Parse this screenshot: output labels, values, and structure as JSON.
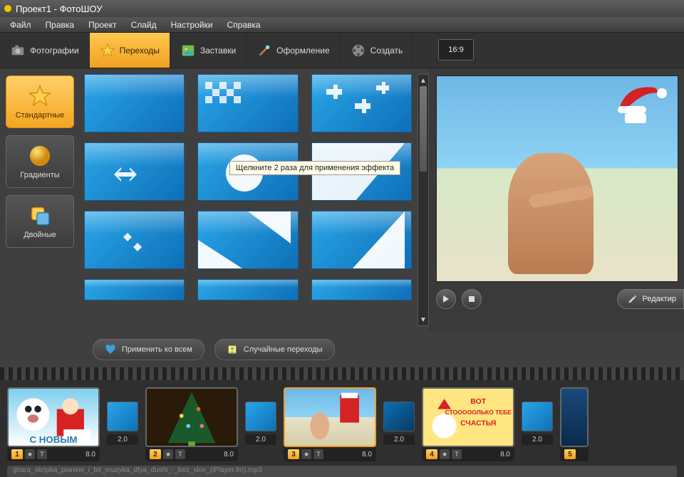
{
  "title": "Проект1 - ФотоШОУ",
  "menu": [
    "Файл",
    "Правка",
    "Проект",
    "Слайд",
    "Настройки",
    "Справка"
  ],
  "tabs": {
    "photos": "Фотографии",
    "transitions": "Переходы",
    "splash": "Заставки",
    "design": "Оформление",
    "create": "Создать"
  },
  "aspect": "16:9",
  "categories": {
    "standard": "Стандартные",
    "gradients": "Градиенты",
    "double": "Двойные"
  },
  "tooltip": "Щелкните 2 раза для применения эффекта",
  "buttons": {
    "apply_all": "Применить ко всем",
    "random": "Случайные переходы",
    "edit": "Редактир"
  },
  "timeline": {
    "slides": [
      {
        "n": "1",
        "dur": "8.0"
      },
      {
        "n": "2",
        "dur": "8.0"
      },
      {
        "n": "3",
        "dur": "8.0"
      },
      {
        "n": "4",
        "dur": "8.0"
      },
      {
        "n": "5",
        "dur": ""
      }
    ],
    "trans_dur": "2.0",
    "audio": "gitara_skripka_pianino_i_bit_muzyka_dlya_dushi_-_bez_slov_(iPlayer.fm).mp3"
  },
  "slide4_text": {
    "l1": "ВОТ",
    "l2": "СТОООООЛЬКО ТЕБЕ",
    "l3": "СЧАСТЬЯ"
  }
}
